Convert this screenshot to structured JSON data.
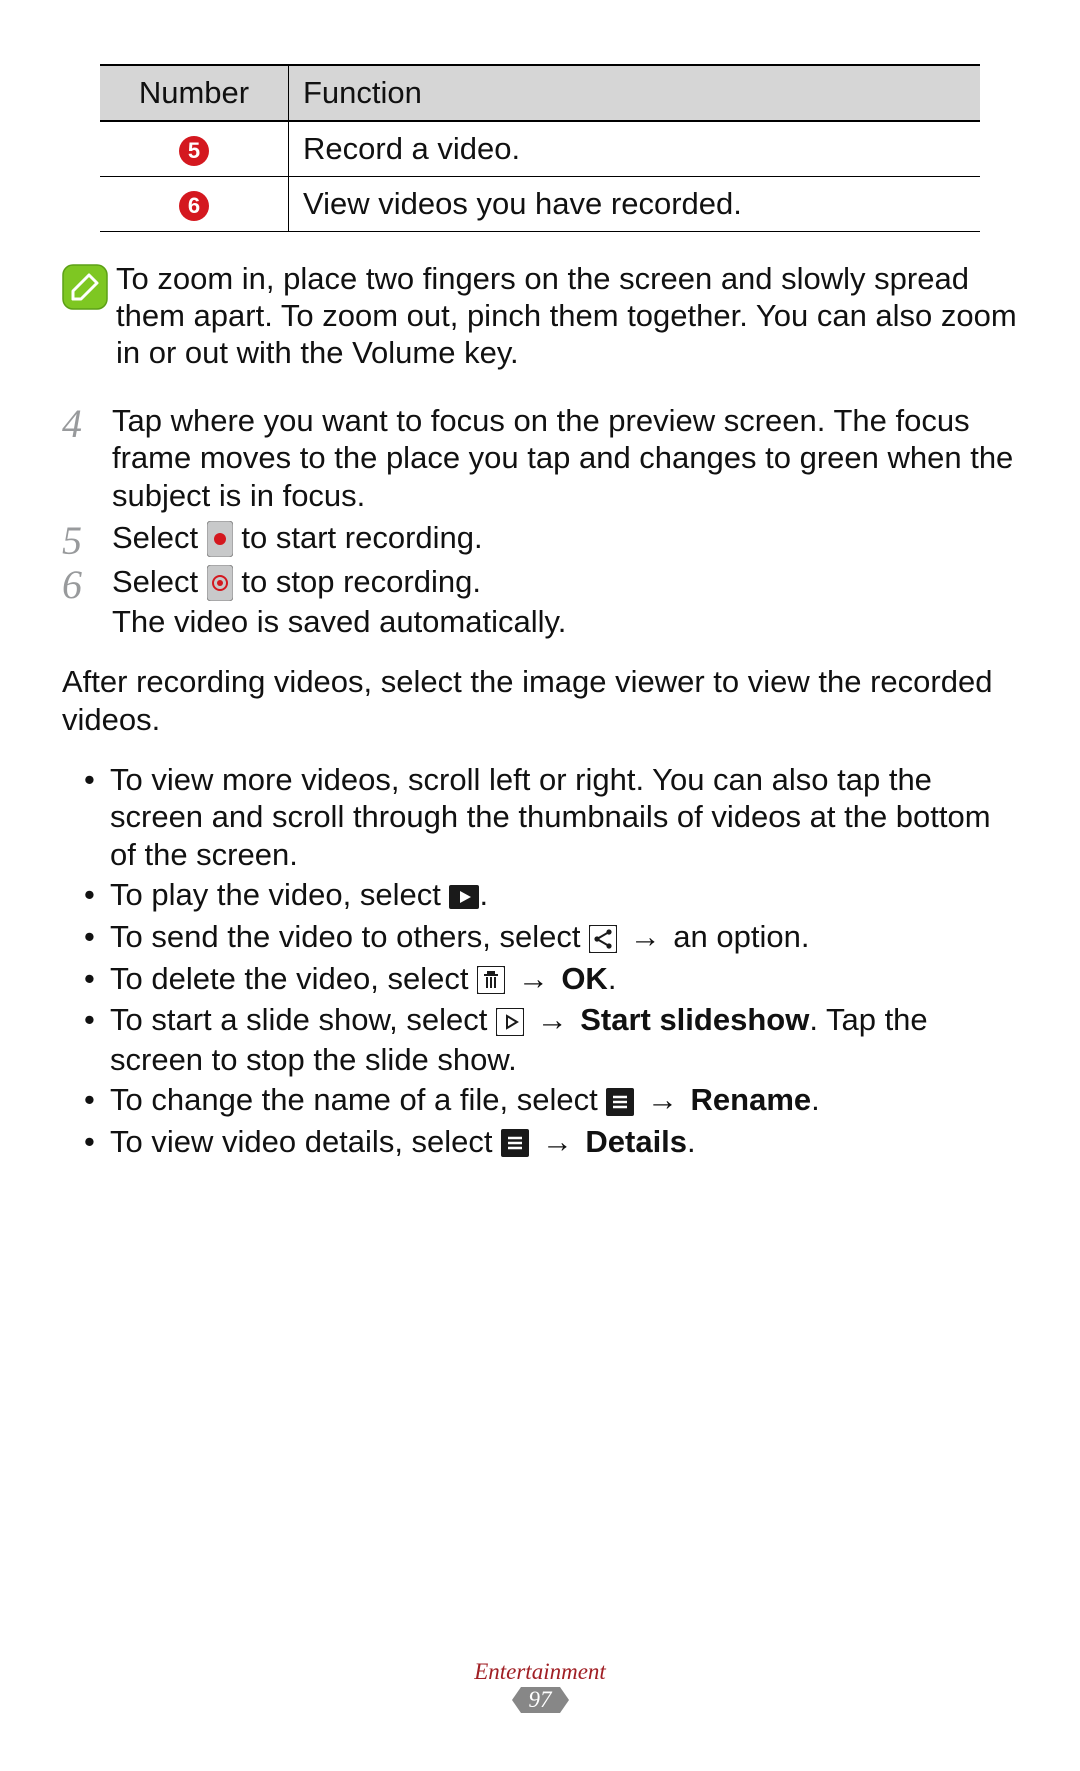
{
  "table": {
    "headers": {
      "number": "Number",
      "function": "Function"
    },
    "rows": [
      {
        "num": "5",
        "func": "Record a video."
      },
      {
        "num": "6",
        "func": "View videos you have recorded."
      }
    ]
  },
  "note": {
    "text": "To zoom in, place two fingers on the screen and slowly spread them apart. To zoom out, pinch them together. You can also zoom in or out with the Volume key."
  },
  "steps": {
    "s4": {
      "num": "4",
      "text": "Tap where you want to focus on the preview screen. The focus frame moves to the place you tap and changes to green when the subject is in focus."
    },
    "s5": {
      "num": "5",
      "pre": "Select ",
      "post": " to start recording."
    },
    "s6": {
      "num": "6",
      "pre": "Select ",
      "post": " to stop recording.",
      "line2": "The video is saved automatically."
    }
  },
  "after_para": "After recording videos, select the image viewer to view the recorded videos.",
  "tips": {
    "t1": "To view more videos, scroll left or right. You can also tap the screen and scroll through the thumbnails of videos at the bottom of the screen.",
    "t2": {
      "pre": "To play the video, select ",
      "post": "."
    },
    "t3": {
      "pre": "To send the video to others, select ",
      "arrow": " → ",
      "post": "an option."
    },
    "t4": {
      "pre": "To delete the video, select ",
      "arrow": " → ",
      "bold": "OK",
      "post": "."
    },
    "t5": {
      "pre": "To start a slide show, select ",
      "arrow": " → ",
      "bold": "Start slideshow",
      "post": ". Tap the screen to stop the slide show."
    },
    "t6": {
      "pre": "To change the name of a file, select ",
      "arrow": " → ",
      "bold": "Rename",
      "post": "."
    },
    "t7": {
      "pre": "To view video details, select ",
      "arrow": " → ",
      "bold": "Details",
      "post": "."
    }
  },
  "footer": {
    "section": "Entertainment",
    "page": "97"
  }
}
